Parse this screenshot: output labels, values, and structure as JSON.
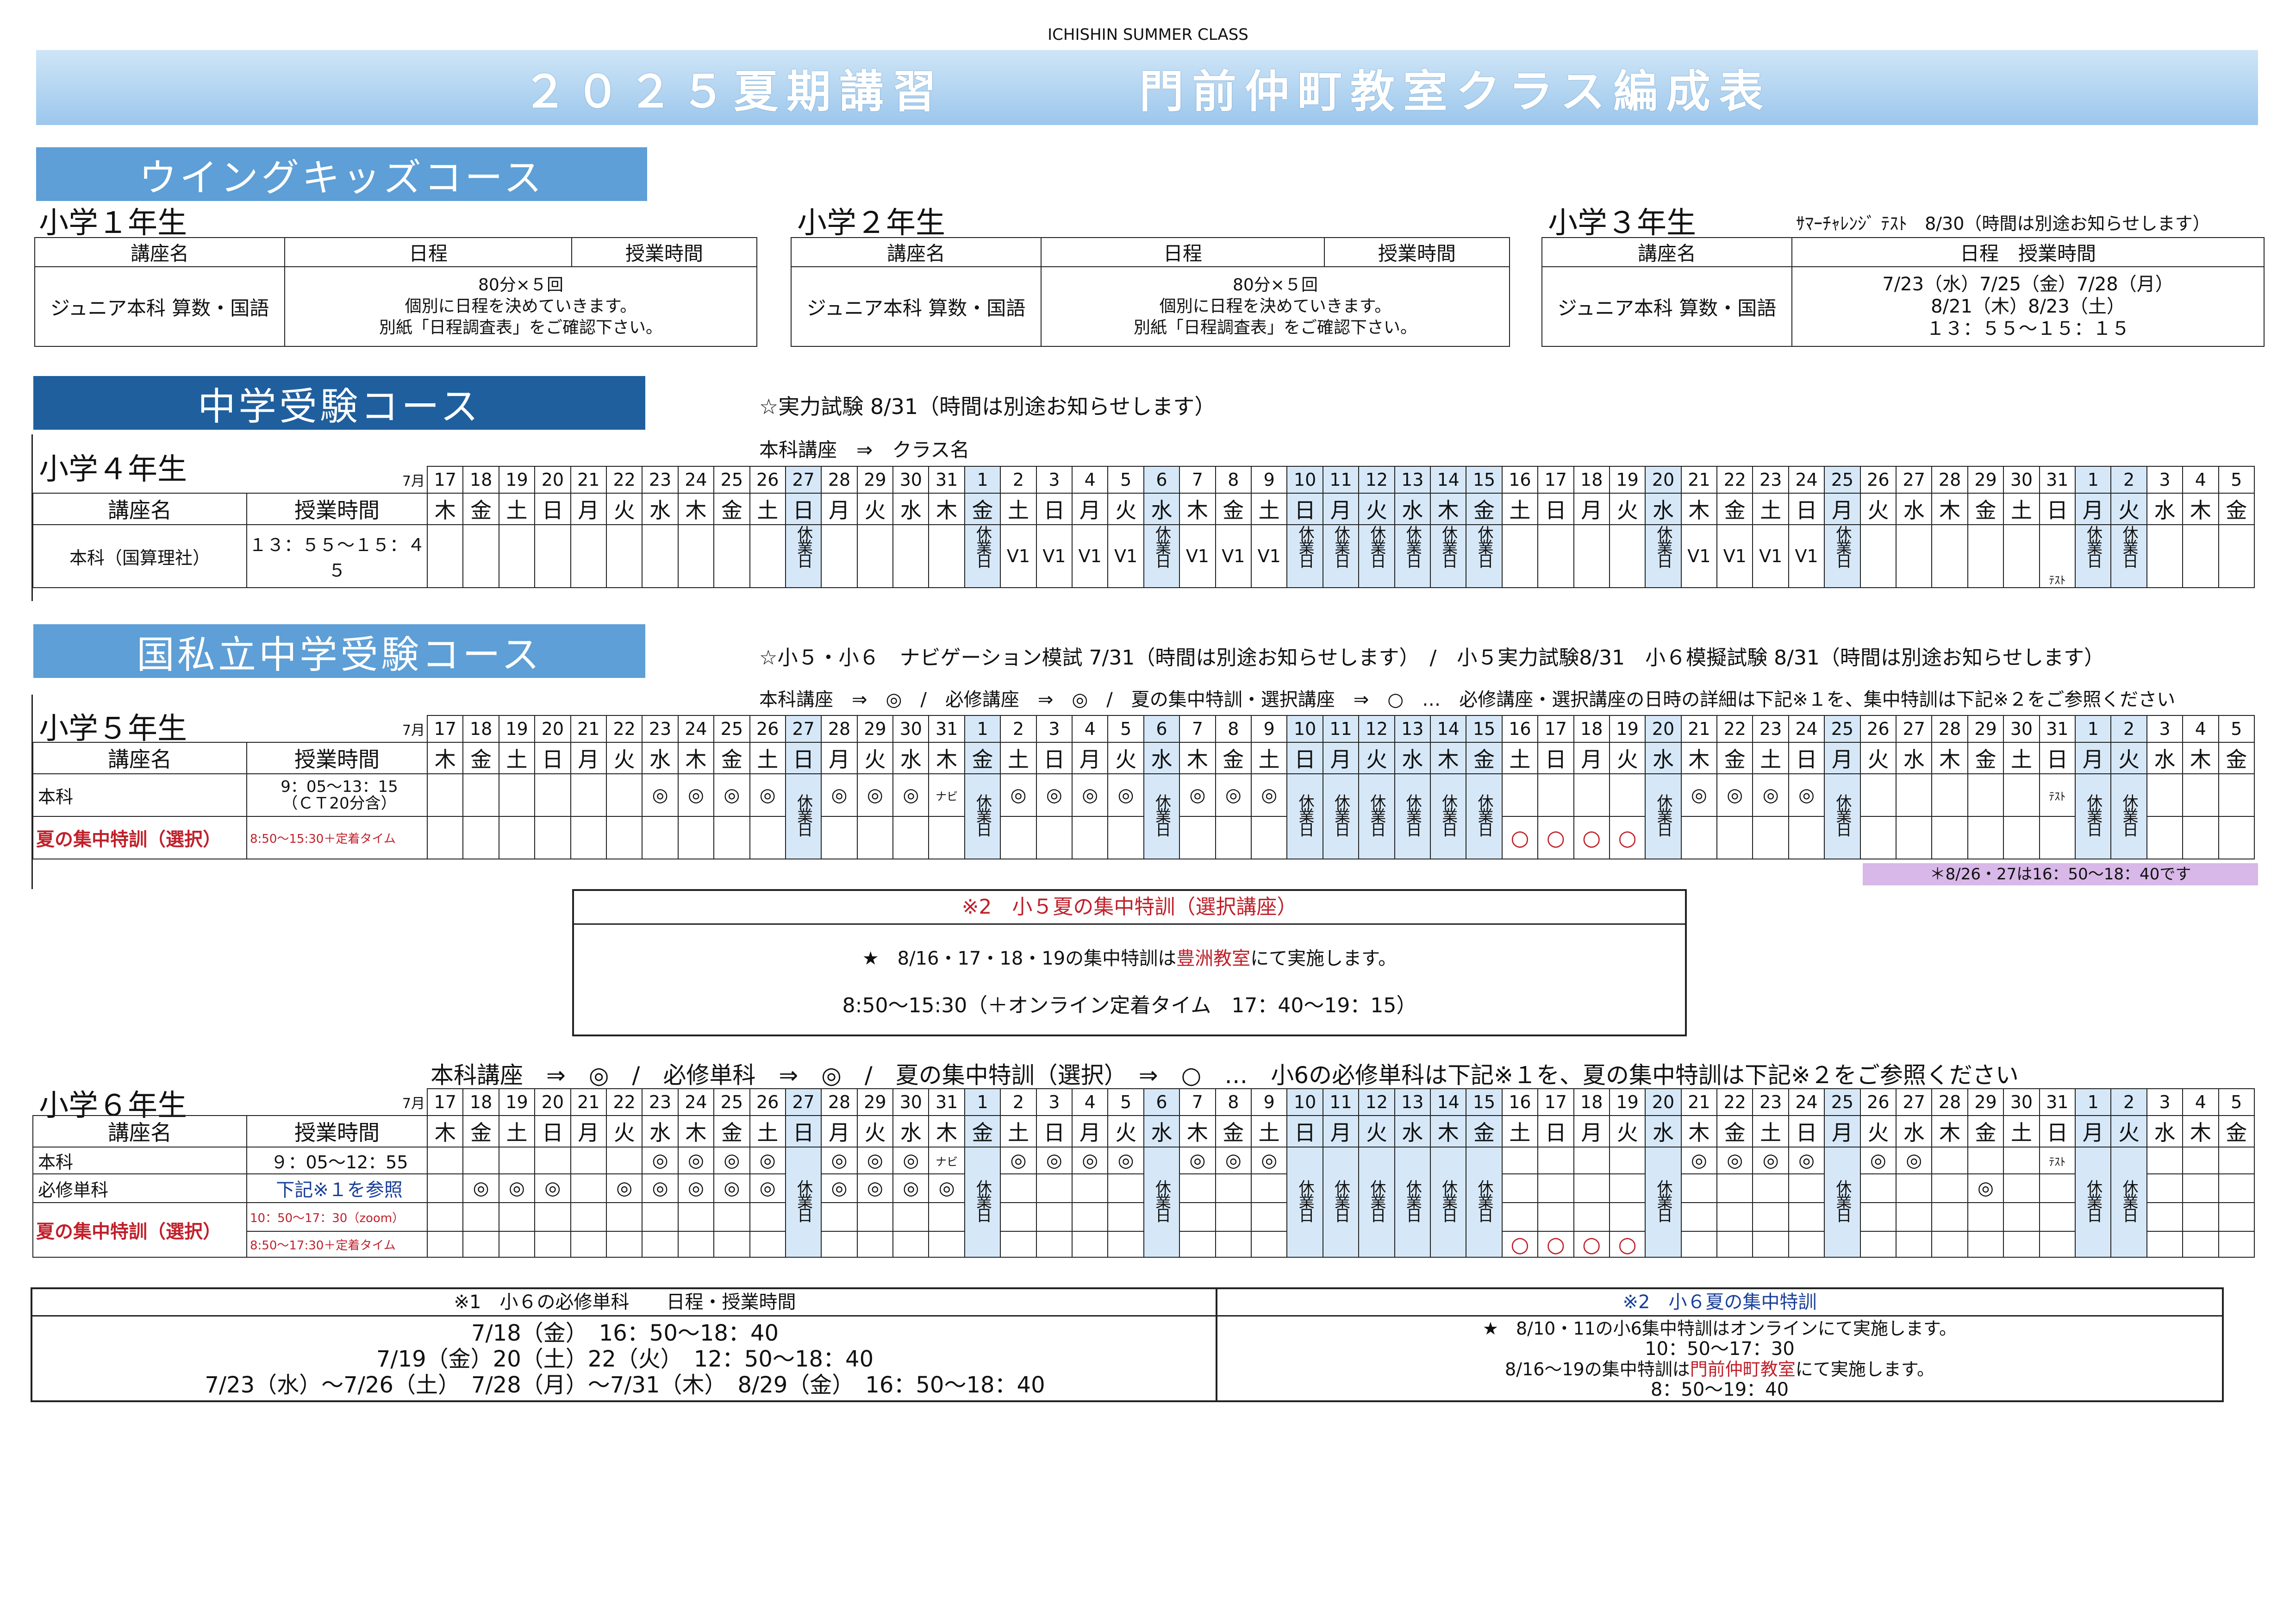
{
  "header": {
    "caption": "ICHISHIN SUMMER CLASS",
    "title_left": "２０２５夏期講習",
    "title_right": "門前仲町教室クラス編成表"
  },
  "wing": {
    "course_title": "ウイングキッズコース",
    "g1": {
      "grade": "小学１年生",
      "col_course": "講座名",
      "col_schedule": "日程",
      "col_time": "授業時間",
      "course": "ジュニア本科 算数・国語",
      "line1": "80分×５回",
      "line2": "個別に日程を決めていきます。",
      "line3": "別紙「日程調査表」をご確認下さい。"
    },
    "g2": {
      "grade": "小学２年生",
      "col_course": "講座名",
      "col_schedule": "日程",
      "col_time": "授業時間",
      "course": "ジュニア本科 算数・国語",
      "line1": "80分×５回",
      "line2": "個別に日程を決めていきます。",
      "line3": "別紙「日程調査表」をご確認下さい。"
    },
    "g3": {
      "grade": "小学３年生",
      "note": "ｻﾏｰﾁｬﾚﾝｼﾞ ﾃｽﾄ　8/30（時間は別途お知らせします）",
      "col_course": "講座名",
      "col_schedule": "日程　授業時間",
      "course": "ジュニア本科 算数・国語",
      "line1": "7/23（水）7/25（金）7/28（月）",
      "line2": "8/21（木）8/23（土）",
      "line3": "１３：５５〜１５：１５"
    }
  },
  "juken": {
    "course_title": "中学受験コース",
    "note": "☆実力試験 8/31（時間は別途お知らせします）",
    "legend": "本科講座　⇒　クラス名",
    "grade": "小学４年生",
    "col_course": "講座名",
    "col_time": "授業時間",
    "row_course": "本科（国算理社）",
    "row_time": "１３：５５〜１５：４５",
    "mark_v1": "V1",
    "mark_test": "ﾃｽﾄ"
  },
  "kokushi": {
    "course_title": "国私立中学受験コース",
    "note": "☆小５・小６　ナビゲーション模試 7/31（時間は別途お知らせします）　/　小５実力試験8/31　小６模擬試験 8/31（時間は別途お知らせします）",
    "legend5": "本科講座　⇒　◎　/　必修講座　⇒　◎　/　夏の集中特訓・選択講座　⇒　○　…　必修講座・選択講座の日時の詳細は下記※１を、集中特訓は下記※２をご参照ください",
    "g5": {
      "grade": "小学５年生",
      "col_course": "講座名",
      "col_time": "授業時間",
      "r1_course": "本科",
      "r1_time1": "9：05〜13：15",
      "r1_time2": "（ＣＴ20分含）",
      "r2_course": "夏の集中特訓（選択）",
      "r2_time": "8:50〜15:30＋定着タイム",
      "footnote": "＊8/26・27は16：50〜18：40です"
    },
    "p5": {
      "title": "※2　小５夏の集中特訓（選択講座）",
      "line1a": "★　8/16・17・18・19の集中特訓は",
      "line1b": "豊洲教室",
      "line1c": "にて実施します。",
      "line2": "8:50〜15:30（＋オンライン定着タイム　17：40〜19：15）"
    },
    "legend6": "本科講座　⇒　◎　/　必修単科　⇒　◎　/　夏の集中特訓（選択）　⇒　○　…　小6の必修単科は下記※１を、夏の集中特訓は下記※２をご参照ください",
    "g6": {
      "grade": "小学６年生",
      "col_course": "講座名",
      "col_time": "授業時間",
      "r1_course": "本科",
      "r1_time": "９：05〜12：55",
      "r2_course": "必修単科",
      "r2_time": "下記※１を参照",
      "r3_course": "夏の集中特訓（選択）",
      "r3_time1": "10：50〜17：30（zoom）",
      "r3_time2": "8:50〜17:30＋定着タイム"
    },
    "p6a": {
      "title": "※1　小６の必修単科　　日程・授業時間",
      "line1": "7/18（金）　16：50〜18：40",
      "line2": "7/19（金）20（土）22（火）　12：50〜18：40",
      "line3": "7/23（水）〜7/26（土）　7/28（月）〜7/31（木）　8/29（金）　16：50〜18：40"
    },
    "p6b": {
      "title": "※2　小６夏の集中特訓",
      "line1": "★　8/10・11の小6集中特訓はオンラインにて実施します。",
      "line2": "10：50〜17：30",
      "line3a": "8/16〜19の集中特訓は",
      "line3b": "門前仲町教室",
      "line3c": "にて実施します。",
      "line4": "8：50〜19：40"
    }
  },
  "calendar": {
    "month_label": "7月",
    "days": [
      "17",
      "18",
      "19",
      "20",
      "21",
      "22",
      "23",
      "24",
      "25",
      "26",
      "27",
      "28",
      "29",
      "30",
      "31",
      "1",
      "2",
      "3",
      "4",
      "5",
      "6",
      "7",
      "8",
      "9",
      "10",
      "11",
      "12",
      "13",
      "14",
      "15",
      "16",
      "17",
      "18",
      "19",
      "20",
      "21",
      "22",
      "23",
      "24",
      "25",
      "26",
      "27",
      "28",
      "29",
      "30",
      "31",
      "1",
      "2",
      "3",
      "4",
      "5"
    ],
    "weekdays": [
      "木",
      "金",
      "土",
      "日",
      "月",
      "火",
      "水",
      "木",
      "金",
      "土",
      "日",
      "月",
      "火",
      "水",
      "木",
      "金",
      "土",
      "日",
      "月",
      "火",
      "水",
      "木",
      "金",
      "土",
      "日",
      "月",
      "火",
      "水",
      "木",
      "金",
      "土",
      "日",
      "月",
      "火",
      "水",
      "木",
      "金",
      "土",
      "日",
      "月",
      "火",
      "水",
      "木",
      "金",
      "土",
      "日",
      "月",
      "火",
      "水",
      "木",
      "金"
    ],
    "holiday_label": "休業日",
    "mark_double": "◎",
    "mark_circle": "○",
    "mark_navi": "ナビ",
    "mark_test": "ﾃｽﾄ"
  },
  "colors": {
    "title_bar": "#9cc7ec",
    "section_light": "#5d9fd6",
    "section_dark": "#1f5f9e",
    "holiday": "#d6e8f8",
    "red": "#c0202a",
    "note_purple": "#d8b8e8"
  }
}
